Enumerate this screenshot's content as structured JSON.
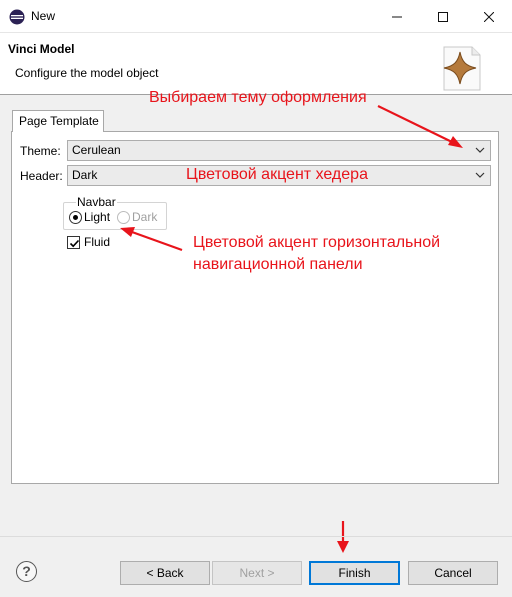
{
  "window": {
    "title": "New"
  },
  "banner": {
    "title": "Vinci Model",
    "description": "Configure the model object"
  },
  "tabs": [
    {
      "label": "Page Template"
    }
  ],
  "form": {
    "theme": {
      "label": "Theme:",
      "value": "Cerulean"
    },
    "header": {
      "label": "Header:",
      "value": "Dark"
    },
    "navbar": {
      "legend": "Navbar",
      "options": [
        {
          "label": "Light",
          "selected": true,
          "enabled": true
        },
        {
          "label": "Dark",
          "selected": false,
          "enabled": false
        }
      ]
    },
    "fluid": {
      "label": "Fluid",
      "checked": true
    }
  },
  "annotations": {
    "theme_note": "Выбираем тему оформления",
    "header_note": "Цветовой акцент хедера",
    "navbar_note_line1": "Цветовой акцент горизонтальной",
    "navbar_note_line2": "навигационной панели",
    "color": "#e8141b"
  },
  "footer": {
    "help": "?",
    "back": "< Back",
    "next": "Next >",
    "finish": "Finish",
    "cancel": "Cancel"
  }
}
